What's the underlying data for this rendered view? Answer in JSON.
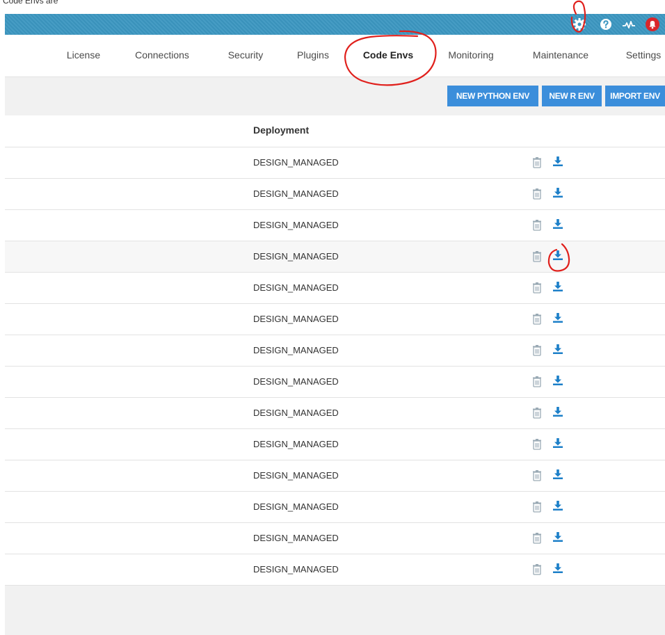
{
  "caption": "Code Envs are",
  "topbar": {
    "icons": [
      "gear-icon",
      "help-icon",
      "activity-icon",
      "bell-icon"
    ],
    "color": "#3c97c1"
  },
  "nav": {
    "tabs": [
      {
        "label": "License"
      },
      {
        "label": "Connections"
      },
      {
        "label": "Security"
      },
      {
        "label": "Plugins"
      },
      {
        "label": "Code Envs",
        "active": true
      },
      {
        "label": "Monitoring"
      },
      {
        "label": "Maintenance"
      },
      {
        "label": "Settings"
      }
    ]
  },
  "actions": {
    "new_python": "NEW PYTHON ENV",
    "new_r": "NEW R ENV",
    "import": "IMPORT ENV",
    "button_color": "#3b8edb"
  },
  "table": {
    "column_header": "Deployment",
    "rows": [
      {
        "deployment": "DESIGN_MANAGED"
      },
      {
        "deployment": "DESIGN_MANAGED"
      },
      {
        "deployment": "DESIGN_MANAGED"
      },
      {
        "deployment": "DESIGN_MANAGED"
      },
      {
        "deployment": "DESIGN_MANAGED"
      },
      {
        "deployment": "DESIGN_MANAGED"
      },
      {
        "deployment": "DESIGN_MANAGED"
      },
      {
        "deployment": "DESIGN_MANAGED"
      },
      {
        "deployment": "DESIGN_MANAGED"
      },
      {
        "deployment": "DESIGN_MANAGED"
      },
      {
        "deployment": "DESIGN_MANAGED"
      },
      {
        "deployment": "DESIGN_MANAGED"
      },
      {
        "deployment": "DESIGN_MANAGED"
      },
      {
        "deployment": "DESIGN_MANAGED"
      }
    ],
    "row_icons": [
      "trash-icon",
      "download-icon"
    ]
  },
  "annotation_color": "#e0201c"
}
